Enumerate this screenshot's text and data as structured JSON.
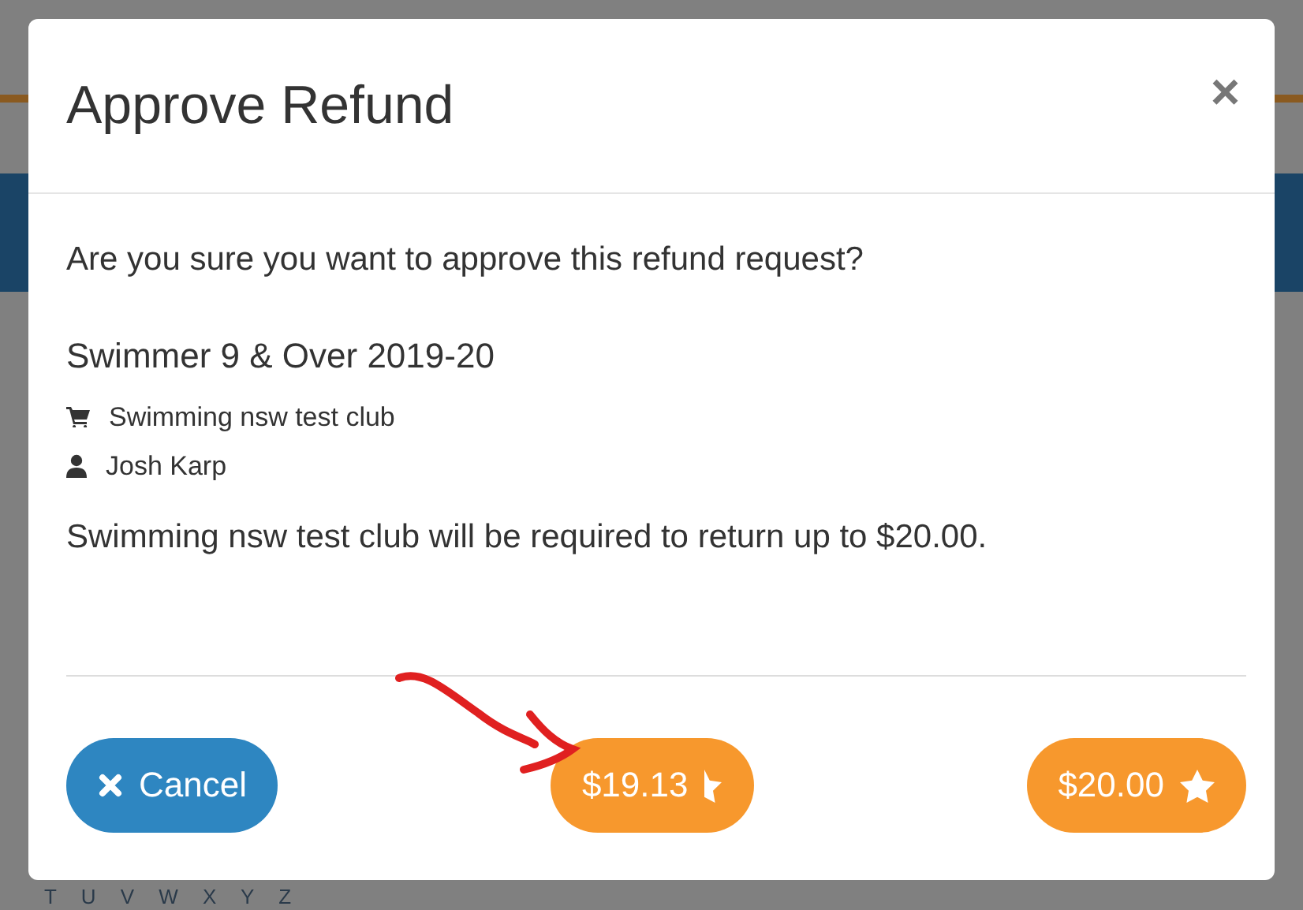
{
  "dialog": {
    "title": "Approve Refund",
    "close": "×",
    "question": "Are you sure you want to approve this refund request?",
    "item": "Swimmer 9 & Over 2019-20",
    "club": "Swimming nsw test club",
    "member": "Josh Karp",
    "notice": "Swimming nsw test club will be required to return up to $20.00."
  },
  "buttons": [
    {
      "kind": "cancel",
      "label": "Cancel"
    },
    {
      "kind": "half-star",
      "label": "$19.13"
    },
    {
      "kind": "star",
      "label": "$20.00"
    }
  ],
  "background": {
    "letters": "T U V W X Y Z"
  }
}
